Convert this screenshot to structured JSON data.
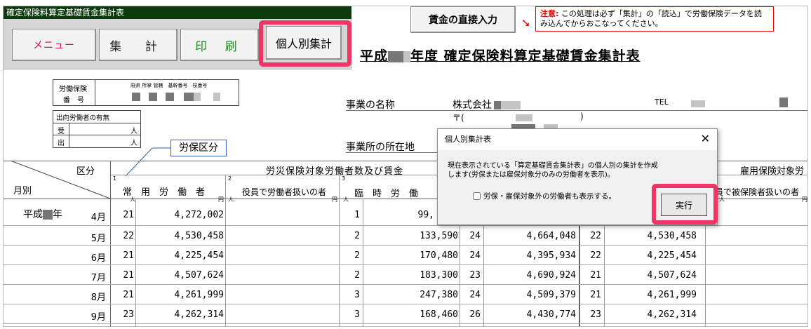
{
  "window": {
    "title": "確定保険料算定基礎賃金集計表"
  },
  "toolbar": {
    "menu_label": "メニュー",
    "sum_label": "集 計",
    "print_label": "印 刷",
    "individual_label": "個人別集計",
    "wage_direct_label": "賃金の直接入力"
  },
  "notice": {
    "label": "注意:",
    "text": "この処理は必ず「集計」の「読込」で労働保険データを読み込んでからおこなってください。"
  },
  "document": {
    "title_prefix": "平成",
    "title_suffix": "年度 確定保険料算定基礎賃金集計表",
    "labor_ins_label": "労働保険",
    "number_label": "番　号",
    "code_headers": "府県 所掌 管轄　基幹番号　枝番号",
    "dispatch_label": "出向労働者の有無",
    "in_label": "受",
    "out_label": "出",
    "person_unit": "人",
    "business_name_label": "事業の名称",
    "company_prefix": "株式会社",
    "tel_label": "TEL",
    "postal_label": "〒(",
    "postal_close": ")",
    "address_label": "事業所の所在地",
    "labor_class_tag": "労保区分"
  },
  "table": {
    "kubun_label": "区分",
    "month_label": "月別",
    "workers_comp_header": "労災保険対象労働者数及び賃金",
    "employment_header": "雇用保険対象労",
    "col1_num": "1",
    "col1_label": "常　用　労　働　者",
    "col2_num": "2",
    "col2_label": "役員で労働者扱いの者",
    "col3_num": "3",
    "col3_label": "臨　時　労　働",
    "col_emp_label": "役員で被保険者扱いの者",
    "person_unit": "人",
    "yen_unit": "円",
    "era_label": "平成",
    "year_label": "年",
    "rows": [
      {
        "month": "4月",
        "regular_count": "21",
        "regular_wage": "4,272,002",
        "temp_count": "1",
        "temp_wage": "99,",
        "total_count": "",
        "total_wage": "",
        "emp_count": "",
        "emp_wage": ""
      },
      {
        "month": "5月",
        "regular_count": "22",
        "regular_wage": "4,530,458",
        "temp_count": "2",
        "temp_wage": "133,590",
        "total_count": "24",
        "total_wage": "4,664,048",
        "emp_count": "22",
        "emp_wage": "4,530,458"
      },
      {
        "month": "6月",
        "regular_count": "21",
        "regular_wage": "4,225,454",
        "temp_count": "2",
        "temp_wage": "170,480",
        "total_count": "24",
        "total_wage": "4,395,934",
        "emp_count": "22",
        "emp_wage": "4,225,454"
      },
      {
        "month": "7月",
        "regular_count": "21",
        "regular_wage": "4,507,624",
        "temp_count": "2",
        "temp_wage": "183,300",
        "total_count": "23",
        "total_wage": "4,690,924",
        "emp_count": "21",
        "emp_wage": "4,507,624"
      },
      {
        "month": "8月",
        "regular_count": "21",
        "regular_wage": "4,261,999",
        "temp_count": "3",
        "temp_wage": "247,380",
        "total_count": "24",
        "total_wage": "4,509,379",
        "emp_count": "21",
        "emp_wage": "4,261,999"
      },
      {
        "month": "9月",
        "regular_count": "23",
        "regular_wage": "4,262,314",
        "temp_count": "3",
        "temp_wage": "168,460",
        "total_count": "26",
        "total_wage": "4,430,774",
        "emp_count": "23",
        "emp_wage": "4,262,314"
      }
    ]
  },
  "dialog": {
    "title": "個人別集計表",
    "close_label": "✕",
    "message": "現在表示されている「算定基礎賃金集計表」の個人別の集計を作成します(労保または雇保対象分のみの労働者を表示)。",
    "checkbox_label": "労保・雇保対象外の労働者も表示する。",
    "run_label": "実行"
  },
  "colors": {
    "highlight": "#f03466",
    "titlebar": "#0c3a0c",
    "menu_text": "#d0103a",
    "print_text": "#1a8a1a",
    "notice_red": "#ee0000"
  }
}
